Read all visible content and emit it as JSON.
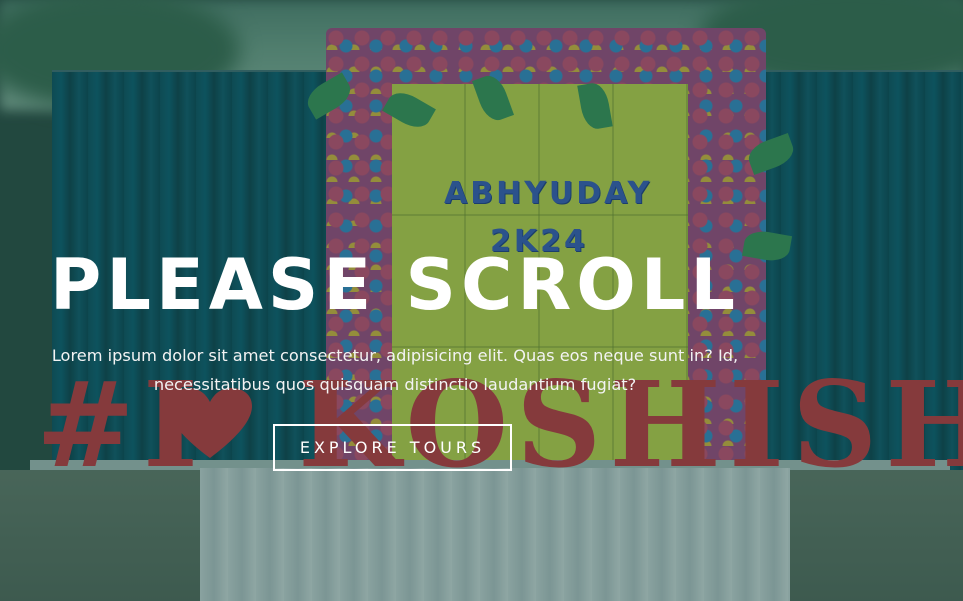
{
  "hero": {
    "background_image": "stage-decoration-photo",
    "headline": "PLEASE SCROLL",
    "subtext": "Lorem ipsum dolor sit amet consectetur, adipisicing elit. Quas eos neque sunt in? Id, necessitatibus quos quisquam distinctio laudantium fugiat?",
    "cta_label": "EXPLORE TOURS"
  },
  "photo": {
    "board_title": "ABHYUDAY",
    "board_year": "2K24",
    "letters": "#I KOSHISH",
    "heart_icon": "heart-icon"
  },
  "colors": {
    "overlay": "#14463A",
    "headline": "#FFFFFF",
    "button_border": "#FFFFFF",
    "letters": "#D8323F",
    "board": "#D6E44A",
    "curtain": "#0A5D79"
  }
}
